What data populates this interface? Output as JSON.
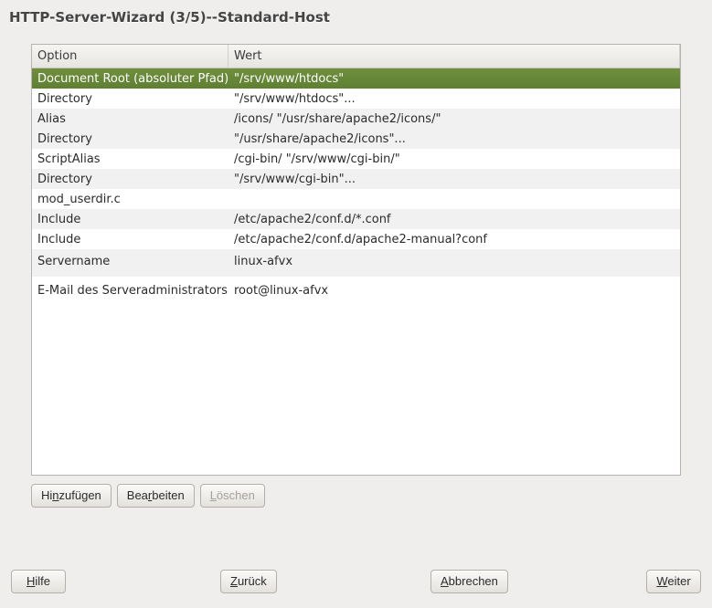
{
  "title": "HTTP-Server-Wizard (3/5)--Standard-Host",
  "table": {
    "headers": {
      "option": "Option",
      "wert": "Wert"
    },
    "rows": [
      {
        "option": "Document Root (absoluter Pfad)",
        "wert": "\"/srv/www/htdocs\"",
        "selected": true
      },
      {
        "option": "Directory",
        "wert": "\"/srv/www/htdocs\"..."
      },
      {
        "option": "Alias",
        "wert": "/icons/ \"/usr/share/apache2/icons/\"",
        "striped": true
      },
      {
        "option": "Directory",
        "wert": "\"/usr/share/apache2/icons\"...",
        "striped": true
      },
      {
        "option": "ScriptAlias",
        "wert": "/cgi-bin/ \"/srv/www/cgi-bin/\""
      },
      {
        "option": "Directory",
        "wert": "\"/srv/www/cgi-bin\"...",
        "striped": true
      },
      {
        "option": "mod_userdir.c",
        "wert": ""
      },
      {
        "option": "Include",
        "wert": "/etc/apache2/conf.d/*.conf",
        "striped": true
      },
      {
        "option": "Include",
        "wert": "/etc/apache2/conf.d/apache2-manual?conf"
      },
      {
        "option": "Servername",
        "wert": "linux-afvx",
        "striped": true,
        "tall": true
      },
      {
        "option": "E-Mail des Serveradministrators",
        "wert": "root@linux-afvx",
        "tall2": true
      }
    ]
  },
  "buttons": {
    "add_pre": "Hi",
    "add_mn": "n",
    "add_post": "zufügen",
    "edit_pre": "Bea",
    "edit_mn": "r",
    "edit_post": "beiten",
    "delete_pre": "",
    "delete_mn": "L",
    "delete_post": "öschen",
    "help_pre": "",
    "help_mn": "H",
    "help_post": "ilfe",
    "back_pre": "",
    "back_mn": "Z",
    "back_post": "urück",
    "cancel_pre": "",
    "cancel_mn": "A",
    "cancel_post": "bbrechen",
    "next_pre": "",
    "next_mn": "W",
    "next_post": "eiter"
  }
}
